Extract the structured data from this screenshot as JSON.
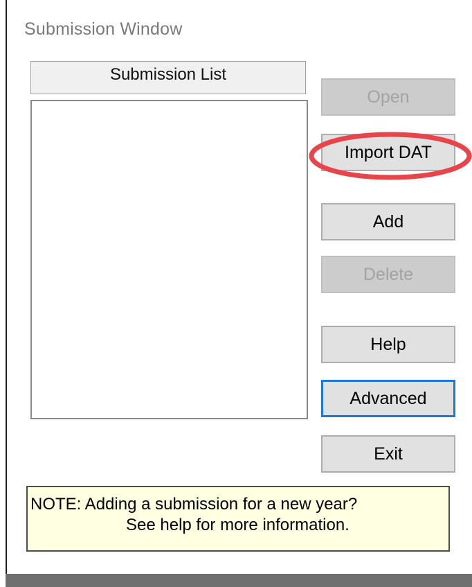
{
  "window": {
    "title": "Submission Window"
  },
  "submission_list": {
    "header": "Submission List",
    "items": []
  },
  "buttons": {
    "open": "Open",
    "import_dat": "Import DAT",
    "add": "Add",
    "delete": "Delete",
    "help": "Help",
    "advanced": "Advanced",
    "exit": "Exit"
  },
  "note": {
    "line1": "NOTE: Adding a submission for a new year?",
    "line2": "See help for more information."
  },
  "colors": {
    "highlight_ring": "#e8454b",
    "focus_border": "#1c7ad6",
    "note_background": "#ffffe1"
  }
}
